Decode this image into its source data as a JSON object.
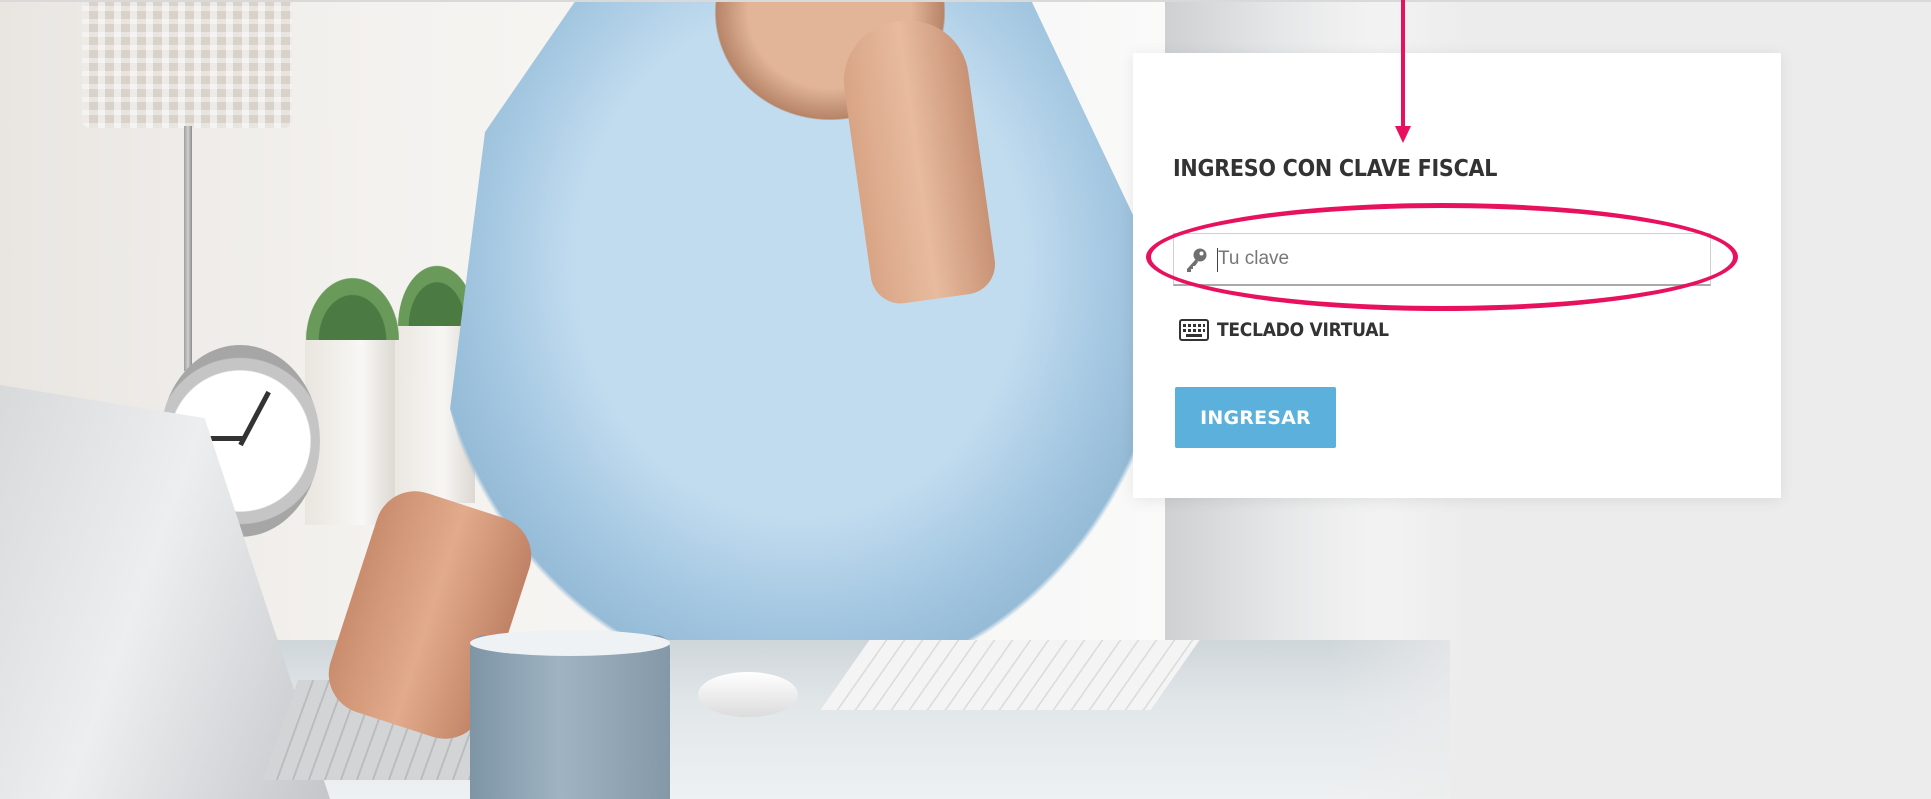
{
  "login": {
    "title": "INGRESO CON CLAVE FISCAL",
    "password_placeholder": "Tu clave",
    "password_value": "",
    "virtual_keyboard_label": "TECLADO VIRTUAL",
    "submit_label": "INGRESAR"
  },
  "icons": {
    "password_field": "key-icon",
    "virtual_keyboard": "keyboard-icon"
  },
  "colors": {
    "submit_button": "#5bb1dc",
    "annotation": "#e8115e",
    "title_text": "#333333",
    "card_background": "#ffffff"
  }
}
